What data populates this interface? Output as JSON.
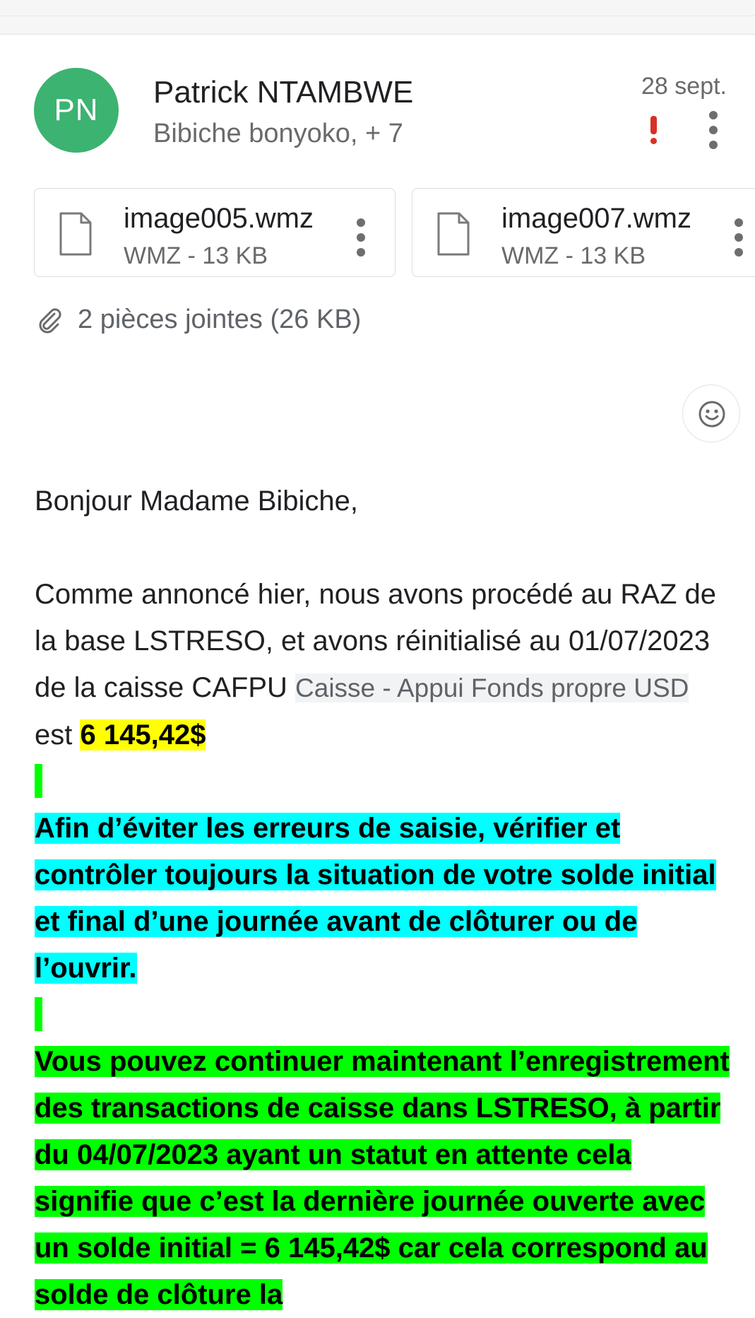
{
  "header": {
    "avatar_initials": "PN",
    "avatar_color": "#3cb371",
    "sender_name": "Patrick NTAMBWE",
    "recipients": "Bibiche bonyoko, + 7",
    "date": "28 sept.",
    "important_icon": "exclamation-icon",
    "important_color": "#d93025",
    "more_icon": "more-vert-icon"
  },
  "attachments": {
    "items": [
      {
        "name": "image005.wmz",
        "meta": "WMZ - 13 KB",
        "icon": "file-icon"
      },
      {
        "name": "image007.wmz",
        "meta": "WMZ - 13 KB",
        "icon": "file-icon"
      }
    ],
    "summary": "2 pièces jointes (26 KB)",
    "summary_icon": "paperclip-icon"
  },
  "reaction_icon": "smiley-icon",
  "message": {
    "greeting": "Bonjour Madame Bibiche,",
    "intro": "Comme annoncé hier, nous avons procédé au RAZ de la base LSTRESO, et avons réinitialisé au 01/07/2023 de la caisse CAFPU ",
    "chip": "Caisse - Appui Fonds propre USD",
    "mid": " est ",
    "amount": "6 145,42$",
    "cyan_paragraph": "Afin d’éviter les erreurs de saisie, vérifier et contrôler toujours la situation de votre solde initial et final d’une journée avant de clôturer ou de l’ouvrir.",
    "green_paragraph": "Vous pouvez continuer maintenant l’enregistrement des transactions de caisse dans LSTRESO, à partir du 04/07/2023 ayant un statut en attente cela signifie que c’est la dernière journée ouverte avec un solde initial = 6 145,42$ car cela correspond au solde de clôture la"
  },
  "colors": {
    "highlight_yellow": "#ffff00",
    "highlight_cyan": "#00ffff",
    "highlight_green": "#00ff00"
  }
}
